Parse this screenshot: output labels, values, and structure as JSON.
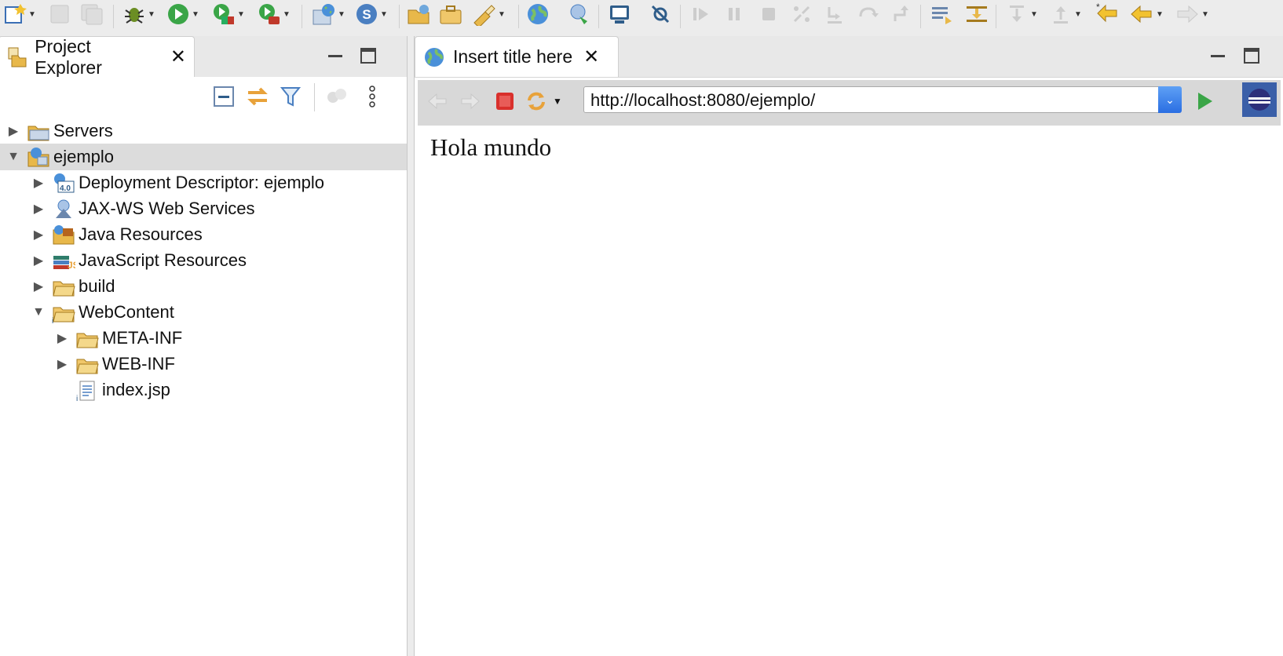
{
  "left_view": {
    "tab_title": "Project Explorer",
    "tree": [
      {
        "label": "Servers",
        "expanded": false,
        "depth": 0,
        "icon": "server-folder-icon"
      },
      {
        "label": "ejemplo",
        "expanded": true,
        "depth": 0,
        "icon": "web-project-icon",
        "selected": true
      },
      {
        "label": "Deployment Descriptor: ejemplo",
        "expanded": false,
        "depth": 1,
        "icon": "deployment-descriptor-icon"
      },
      {
        "label": "JAX-WS Web Services",
        "expanded": false,
        "depth": 1,
        "icon": "web-services-icon"
      },
      {
        "label": "Java Resources",
        "expanded": false,
        "depth": 1,
        "icon": "java-resources-icon"
      },
      {
        "label": "JavaScript Resources",
        "expanded": false,
        "depth": 1,
        "icon": "javascript-resources-icon"
      },
      {
        "label": "build",
        "expanded": false,
        "depth": 1,
        "icon": "folder-icon"
      },
      {
        "label": "WebContent",
        "expanded": true,
        "depth": 1,
        "icon": "folder-icon"
      },
      {
        "label": "META-INF",
        "expanded": false,
        "depth": 2,
        "icon": "folder-icon"
      },
      {
        "label": "WEB-INF",
        "expanded": false,
        "depth": 2,
        "icon": "folder-icon"
      },
      {
        "label": "index.jsp",
        "expanded": null,
        "depth": 2,
        "icon": "jsp-file-icon"
      }
    ]
  },
  "right_view": {
    "tab_title": "Insert title here",
    "url": "http://localhost:8080/ejemplo/",
    "page_text": "Hola mundo"
  },
  "colors": {
    "selection": "#dcdcdc",
    "folder": "#e8b84a",
    "stop": "#d9302c",
    "go": "#3aa547"
  }
}
